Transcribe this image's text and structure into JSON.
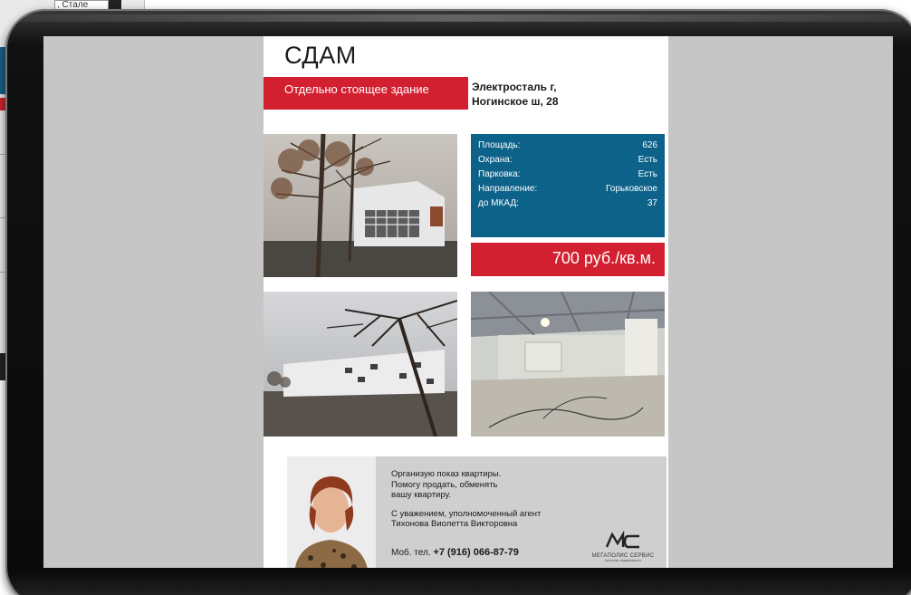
{
  "background_window": {
    "field_text": ", Стале"
  },
  "flyer": {
    "title": "СДАМ",
    "type_label": "Отдельно стоящее здание",
    "address_line1": "Электросталь г,",
    "address_line2": "Ногинское ш, 28",
    "details": [
      {
        "label": "Площадь:",
        "value": "626"
      },
      {
        "label": "Охрана:",
        "value": "Есть"
      },
      {
        "label": "Парковка:",
        "value": "Есть"
      },
      {
        "label": "Направление:",
        "value": "Горьковское"
      },
      {
        "label": "до МКАД:",
        "value": "37"
      }
    ],
    "price": "700 руб./кв.м.",
    "agent": {
      "line1": "Организую показ квартиры.",
      "line2": "Помогу продать, обменять",
      "line3": "вашу квартиру.",
      "line4": "С уважением, уполномоченный агент",
      "line5": "Тихонова Виолетта Викторовна",
      "phone_label": "Моб. тел.",
      "phone_number": "+7 (916) 066-87-79"
    },
    "logo": {
      "mark": "MC",
      "name": "МЕГАПОЛИС СЕРВИС",
      "tagline": "Агентство недвижимости"
    }
  },
  "colors": {
    "accent_red": "#d32030",
    "info_blue": "#0d6289",
    "screen_gray": "#c6c6c6"
  }
}
